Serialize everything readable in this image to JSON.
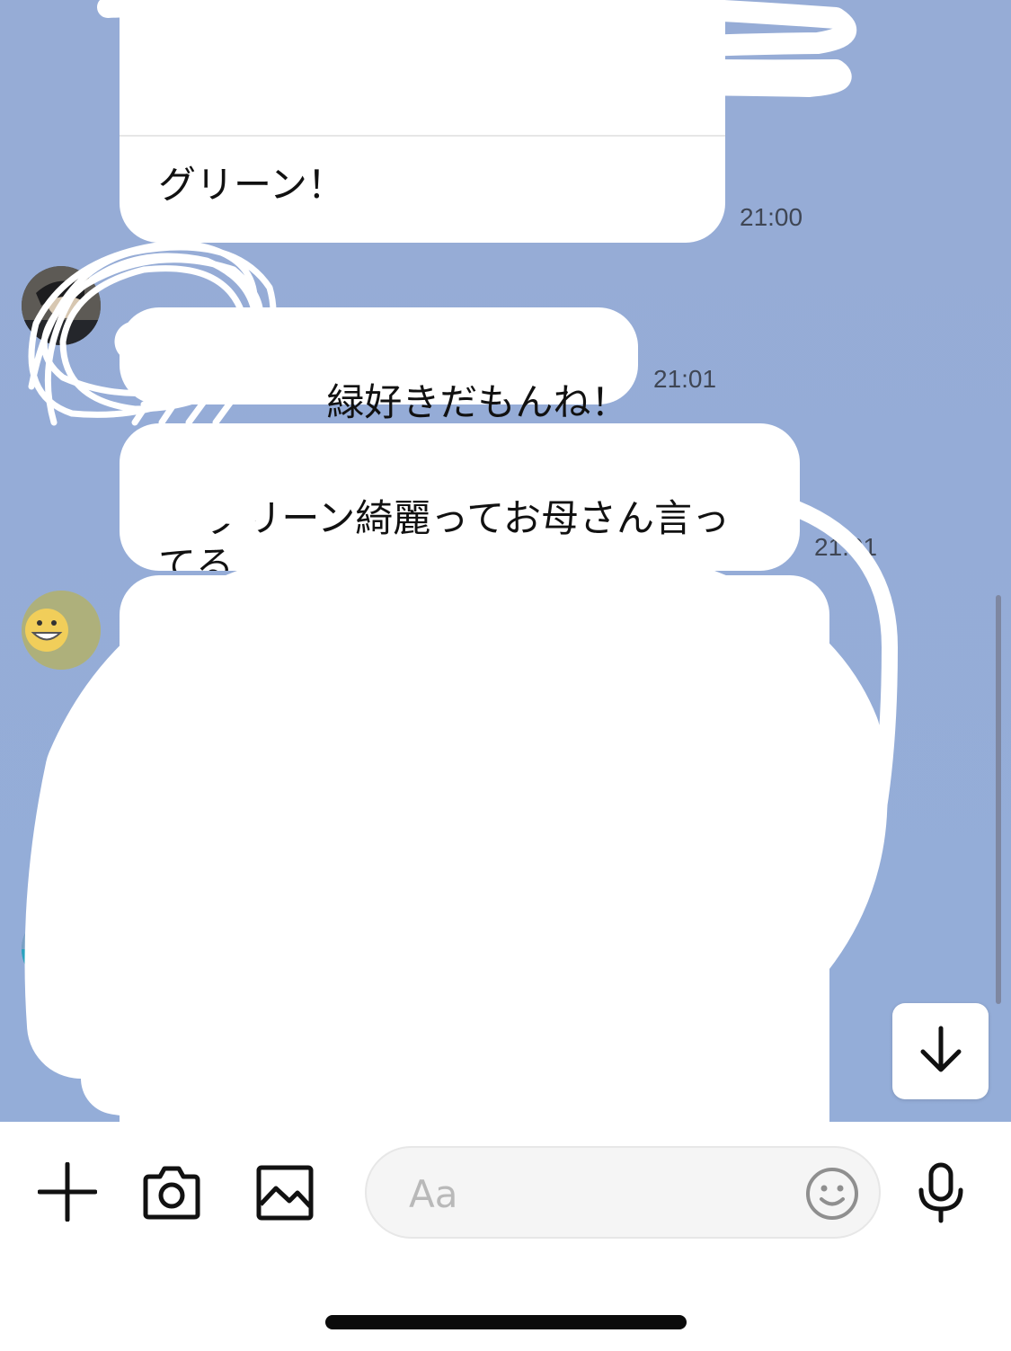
{
  "theme": {
    "chat_background": "#96acd6",
    "bubble_color": "#ffffff",
    "timestamp_color": "#3f4654",
    "icon_color": "#111111"
  },
  "messages": [
    {
      "text": "グリーン！",
      "time": "21:00"
    },
    {
      "text": "緑好きだもんね！",
      "time": "21:01"
    },
    {
      "text": "グリーン綺麗ってお母さん言ってる",
      "time": "21:01"
    }
  ],
  "composer": {
    "placeholder": "Aa",
    "icons": [
      "plus-icon",
      "camera-icon",
      "image-icon",
      "emoji-icon",
      "microphone-icon"
    ]
  },
  "scroll_down": {
    "icon": "arrow-down-icon"
  }
}
